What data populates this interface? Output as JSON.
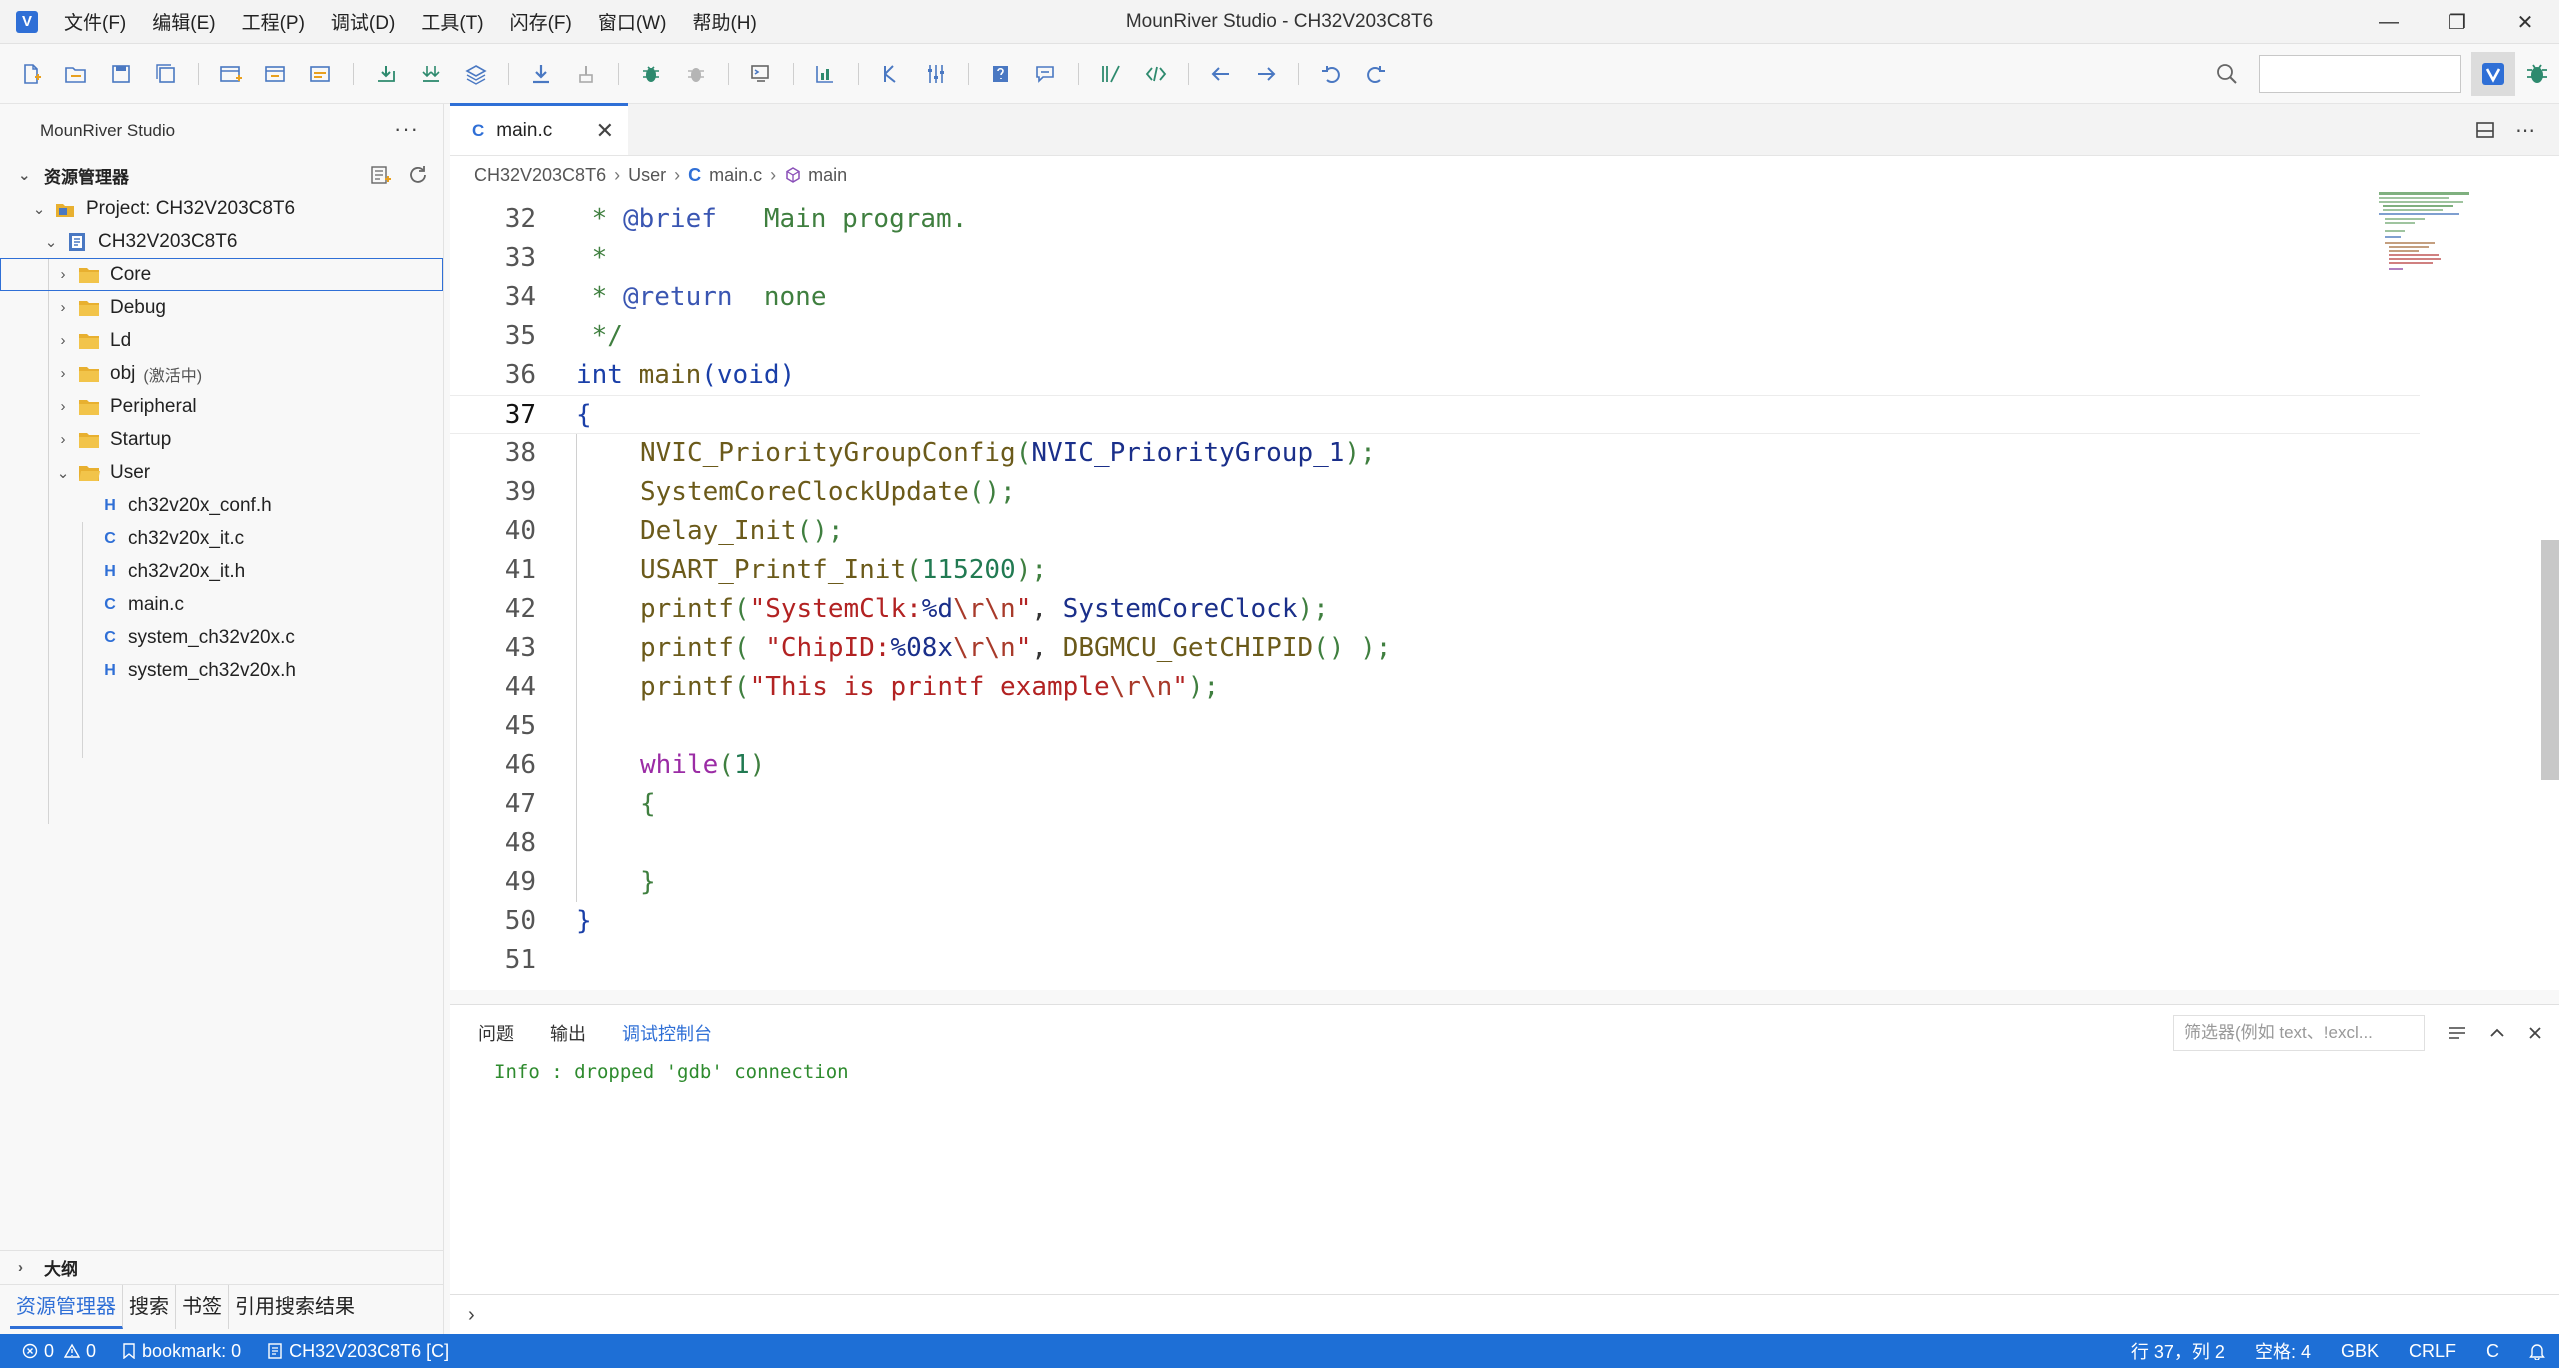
{
  "window": {
    "title": "MounRiver Studio - CH32V203C8T6",
    "logo": "V",
    "minimize": "—",
    "restore": "❐",
    "close": "✕"
  },
  "menu": [
    "文件(F)",
    "编辑(E)",
    "工程(P)",
    "调试(D)",
    "工具(T)",
    "闪存(F)",
    "窗口(W)",
    "帮助(H)"
  ],
  "sidebar": {
    "header": "MounRiver Studio",
    "more": "···",
    "section_title": "资源管理器",
    "project_label": "Project: CH32V203C8T6",
    "project_node": "CH32V203C8T6",
    "folders": [
      {
        "label": "Core",
        "suffix": ""
      },
      {
        "label": "Debug",
        "suffix": ""
      },
      {
        "label": "Ld",
        "suffix": ""
      },
      {
        "label": "obj",
        "suffix": "(激活中)"
      },
      {
        "label": "Peripheral",
        "suffix": ""
      },
      {
        "label": "Startup",
        "suffix": ""
      },
      {
        "label": "User",
        "suffix": ""
      }
    ],
    "user_files": [
      {
        "glyph": "H",
        "label": "ch32v20x_conf.h"
      },
      {
        "glyph": "C",
        "label": "ch32v20x_it.c"
      },
      {
        "glyph": "H",
        "label": "ch32v20x_it.h"
      },
      {
        "glyph": "C",
        "label": "main.c"
      },
      {
        "glyph": "C",
        "label": "system_ch32v20x.c"
      },
      {
        "glyph": "H",
        "label": "system_ch32v20x.h"
      }
    ],
    "outline": "大纲",
    "tabs": [
      "资源管理器",
      "搜索",
      "书签",
      "引用搜索结果"
    ]
  },
  "editor": {
    "tab_label": "main.c",
    "tab_glyph": "C",
    "tab_close": "✕",
    "breadcrumb": {
      "project": "CH32V203C8T6",
      "folder": "User",
      "file_glyph": "C",
      "file": "main.c",
      "symbol": "main"
    },
    "lines": {
      "n32": "32",
      "n33": "33",
      "n34": "34",
      "n35": "35",
      "n36": "36",
      "n37": "37",
      "n38": "38",
      "n39": "39",
      "n40": "40",
      "n41": "41",
      "n42": "42",
      "n43": "43",
      "n44": "44",
      "n45": "45",
      "n46": "46",
      "n47": "47",
      "n48": "48",
      "n49": "49",
      "n50": "50",
      "n51": "51"
    },
    "code": {
      "l32_star": " * ",
      "l32_tag": "@brief",
      "l32_text": "   Main program.",
      "l33": " *",
      "l34_star": " * ",
      "l34_tag": "@return",
      "l34_text": "  none",
      "l35": " */",
      "l36_kw": "int",
      "l36_fn": "main",
      "l36_open": "(",
      "l36_kw2": "void",
      "l36_close": ")",
      "l37": "{",
      "l38_fn": "NVIC_PriorityGroupConfig",
      "l38_open": "(",
      "l38_arg": "NVIC_PriorityGroup_1",
      "l38_close": ");",
      "l39_fn": "SystemCoreClockUpdate",
      "l39_rest": "();",
      "l40_fn": "Delay_Init",
      "l40_rest": "();",
      "l41_fn": "USART_Printf_Init",
      "l41_open": "(",
      "l41_num": "115200",
      "l41_close": ");",
      "l42_fn": "printf",
      "l42_open": "(",
      "l42_s1": "\"SystemClk:",
      "l42_fmt": "%d",
      "l42_esc": "\\r\\n",
      "l42_s2": "\"",
      "l42_comma": ", ",
      "l42_var": "SystemCoreClock",
      "l42_close": ");",
      "l43_fn": "printf",
      "l43_open": "( ",
      "l43_s1": "\"ChipID:",
      "l43_fmt": "%08x",
      "l43_esc": "\\r\\n",
      "l43_s2": "\"",
      "l43_comma": ", ",
      "l43_fn2": "DBGMCU_GetCHIPID",
      "l43_close": "() );",
      "l44_fn": "printf",
      "l44_open": "(",
      "l44_s1": "\"This is printf example",
      "l44_esc": "\\r\\n",
      "l44_s2": "\"",
      "l44_close": ");",
      "l46_kw": "while",
      "l46_open": "(",
      "l46_num": "1",
      "l46_close": ")",
      "l47": "{",
      "l49": "}",
      "l50": "}"
    }
  },
  "panel": {
    "tabs": [
      "问题",
      "输出",
      "调试控制台"
    ],
    "filter_placeholder": "筛选器(例如 text、!excl...",
    "console_line": "Info : dropped 'gdb' connection",
    "prompt": "›"
  },
  "statusbar": {
    "errors": "0",
    "warnings": "0",
    "bookmark": "bookmark: 0",
    "project": "CH32V203C8T6 [C]",
    "position": "行 37，列 2",
    "indent": "空格: 4",
    "encoding": "GBK",
    "eol": "CRLF",
    "language": "C"
  },
  "colors": {
    "accent": "#2f6fd6",
    "statusbar": "#1e6fd6",
    "folder": "#e8b030",
    "comment": "#3f7f3f",
    "string": "#b22222"
  }
}
